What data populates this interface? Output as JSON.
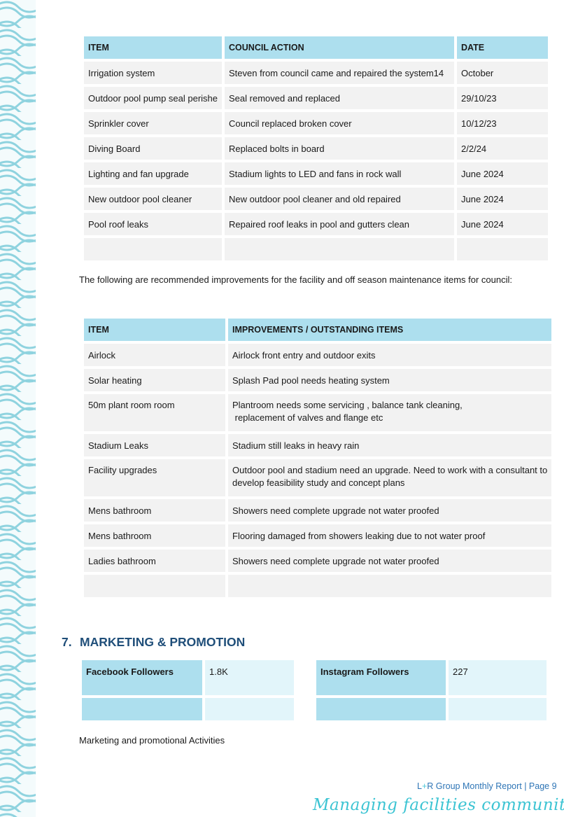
{
  "decor": {
    "wave_color": "#8fd3df",
    "accent": "#addfee",
    "title_color": "#1f4e79"
  },
  "council_table": {
    "headers": [
      "ITEM",
      "COUNCIL ACTION",
      "DATE"
    ],
    "rows": [
      [
        "Irrigation system",
        "Steven from council came and repaired the system14",
        "October"
      ],
      [
        "Outdoor pool pump seal perishe",
        "Seal removed and replaced",
        "29/10/23"
      ],
      [
        "Sprinkler cover",
        "Council replaced broken cover",
        "10/12/23"
      ],
      [
        "Diving Board",
        "Replaced bolts in board",
        "2/2/24"
      ],
      [
        "Lighting and fan upgrade",
        "Stadium lights to LED and fans in rock wall",
        "June 2024"
      ],
      [
        "New outdoor pool cleaner",
        "New outdoor pool cleaner and old repaired",
        "June 2024"
      ],
      [
        "Pool roof leaks",
        "Repaired roof leaks in pool and gutters clean",
        "June 2024"
      ],
      [
        "",
        "",
        ""
      ]
    ]
  },
  "intro_text": "The following are recommended improvements for the facility and off season maintenance items for council:",
  "improvements_table": {
    "headers": [
      "ITEM",
      "IMPROVEMENTS / OUTSTANDING ITEMS"
    ],
    "rows": [
      [
        "Airlock",
        "Airlock front entry and outdoor exits"
      ],
      [
        "Solar heating",
        "Splash Pad pool needs heating system"
      ],
      [
        "50m plant room room",
        "Plantroom needs some servicing , balance tank cleaning,\n replacement of valves and flange etc"
      ],
      [
        "Stadium Leaks",
        "Stadium still leaks in heavy rain"
      ],
      [
        "Facility upgrades",
        "Outdoor pool and stadium need an upgrade. Need to work with a consultant to\ndevelop feasibility study and concept plans"
      ],
      [
        "Mens bathroom",
        "Showers need complete upgrade not water proofed"
      ],
      [
        "Mens bathroom",
        "Flooring damaged from showers leaking due to not water proof"
      ],
      [
        "Ladies bathroom",
        "Showers need complete upgrade not water proofed"
      ],
      [
        "",
        ""
      ]
    ]
  },
  "marketing": {
    "number": "7.",
    "title": "MARKETING & PROMOTION",
    "facebook": {
      "label": "Facebook Followers",
      "value": "1.8K"
    },
    "instagram": {
      "label": "Instagram Followers",
      "value": "227"
    },
    "activities_text": "Marketing and promotional Activities"
  },
  "footer": {
    "brand_left": "L",
    "brand_plus": "+",
    "brand_right": "R Group Monthly Report | Page 9",
    "tagline": "Managing facilities communities love"
  }
}
